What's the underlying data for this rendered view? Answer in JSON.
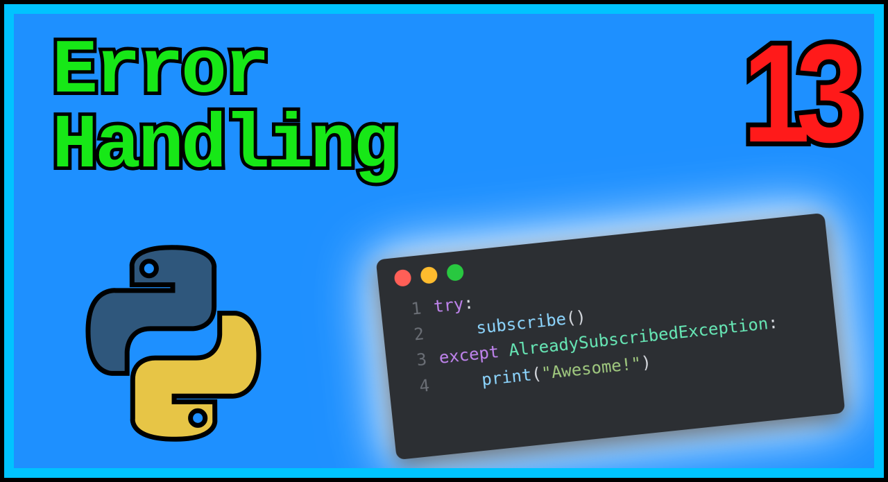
{
  "title": {
    "line1": "Error",
    "line2": "Handling"
  },
  "episode_number": "13",
  "colors": {
    "background": "#1e90ff",
    "border": "#00c3ff",
    "title_fill": "#17e817",
    "episode_fill": "#ff1a1a",
    "outline": "#000000",
    "code_bg": "#2c2f33"
  },
  "window_dots": [
    "red",
    "yellow",
    "green"
  ],
  "code": {
    "lines": [
      {
        "n": "1",
        "tokens": [
          [
            "kw",
            "try"
          ],
          [
            "pn",
            ":"
          ]
        ]
      },
      {
        "n": "2",
        "tokens": [
          [
            "pn",
            "    "
          ],
          [
            "fn",
            "subscribe"
          ],
          [
            "pn",
            "()"
          ]
        ]
      },
      {
        "n": "3",
        "tokens": [
          [
            "kw",
            "except"
          ],
          [
            "pn",
            " "
          ],
          [
            "tp",
            "AlreadySubscribedException"
          ],
          [
            "pn",
            ":"
          ]
        ]
      },
      {
        "n": "4",
        "tokens": [
          [
            "pn",
            "    "
          ],
          [
            "fn",
            "print"
          ],
          [
            "pn",
            "("
          ],
          [
            "str",
            "\"Awesome!\""
          ],
          [
            "pn",
            ")"
          ]
        ]
      }
    ]
  },
  "logo_name": "python-logo"
}
